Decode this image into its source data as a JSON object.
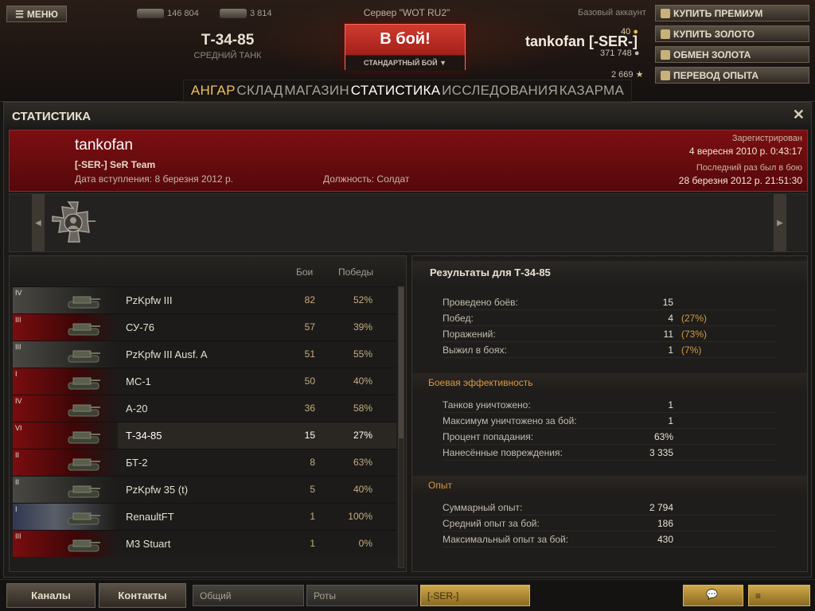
{
  "top": {
    "menu_label": "МЕНЮ",
    "online_count": "146 804",
    "tanks_count": "3 814",
    "vehicle_name": "Т-34-85",
    "vehicle_class": "СРЕДНИЙ ТАНК",
    "server": "Сервер \"WOT RU2\"",
    "battle_label": "В бой!",
    "battle_mode": "СТАНДАРТНЫЙ БОЙ ▼",
    "account_type": "Базовый аккаунт",
    "player": "tankofan [-SER-]",
    "gold": "40",
    "credits": "371 748",
    "free_xp": "2 669",
    "buttons": [
      "КУПИТЬ ПРЕМИУМ",
      "КУПИТЬ ЗОЛОТО",
      "ОБМЕН ЗОЛОТА",
      "ПЕРЕВОД ОПЫТА"
    ]
  },
  "nav": {
    "tabs": [
      "АНГАР",
      "СКЛАД",
      "МАГАЗИН",
      "СТАТИСТИКА",
      "ИССЛЕДОВАНИЯ",
      "КАЗАРМА"
    ]
  },
  "window": {
    "title": "СТАТИСТИКА",
    "close": "✕"
  },
  "profile": {
    "name": "tankofan",
    "clan": "[-SER-] SeR Team",
    "joined": "Дата вступления: 8 березня 2012 р.",
    "role": "Должность: Солдат",
    "registered_label": "Зарегистрирован",
    "registered_value": "4 вересня 2010 р. 0:43:17",
    "last_label": "Последний раз был в бою",
    "last_value": "28 березня 2012 р. 21:51:30"
  },
  "list": {
    "col_battles": "Бои",
    "col_wins": "Победы",
    "rows": [
      {
        "tier": "IV",
        "nation": "ger",
        "name": "PzKpfw III",
        "battles": "82",
        "wins": "52%"
      },
      {
        "tier": "III",
        "nation": "ussr",
        "name": "СУ-76",
        "battles": "57",
        "wins": "39%"
      },
      {
        "tier": "III",
        "nation": "ger",
        "name": "PzKpfw III Ausf. A",
        "battles": "51",
        "wins": "55%"
      },
      {
        "tier": "I",
        "nation": "ussr",
        "name": "МС-1",
        "battles": "50",
        "wins": "40%"
      },
      {
        "tier": "IV",
        "nation": "ussr",
        "name": "А-20",
        "battles": "36",
        "wins": "58%"
      },
      {
        "tier": "VI",
        "nation": "ussr",
        "name": "Т-34-85",
        "battles": "15",
        "wins": "27%"
      },
      {
        "tier": "II",
        "nation": "ussr",
        "name": "БТ-2",
        "battles": "8",
        "wins": "63%"
      },
      {
        "tier": "II",
        "nation": "ger",
        "name": "PzKpfw 35 (t)",
        "battles": "5",
        "wins": "40%"
      },
      {
        "tier": "I",
        "nation": "fra",
        "name": "RenaultFT",
        "battles": "1",
        "wins": "100%"
      },
      {
        "tier": "III",
        "nation": "ussr",
        "name": "M3 Stuart",
        "battles": "1",
        "wins": "0%"
      }
    ]
  },
  "results": {
    "title": "Результаты для Т-34-85",
    "general": [
      {
        "label": "Проведено боёв:",
        "value": "15",
        "pct": ""
      },
      {
        "label": "Побед:",
        "value": "4",
        "pct": "(27%)"
      },
      {
        "label": "Поражений:",
        "value": "11",
        "pct": "(73%)"
      },
      {
        "label": "Выжил в боях:",
        "value": "1",
        "pct": "(7%)"
      }
    ],
    "combat_title": "Боевая эффективность",
    "combat": [
      {
        "label": "Танков уничтожено:",
        "value": "1"
      },
      {
        "label": "Максимум уничтожено за бой:",
        "value": "1"
      },
      {
        "label": "Процент попадания:",
        "value": "63%"
      },
      {
        "label": "Нанесённые повреждения:",
        "value": "3 335"
      }
    ],
    "xp_title": "Опыт",
    "xp": [
      {
        "label": "Суммарный опыт:",
        "value": "2 794"
      },
      {
        "label": "Средний опыт за бой:",
        "value": "186"
      },
      {
        "label": "Максимальный опыт за бой:",
        "value": "430"
      }
    ]
  },
  "bottom": {
    "channels": "Каналы",
    "contacts": "Контакты",
    "chan_general": "Общий",
    "chan_companies": "Роты",
    "chan_clan": "[-SER-]"
  }
}
